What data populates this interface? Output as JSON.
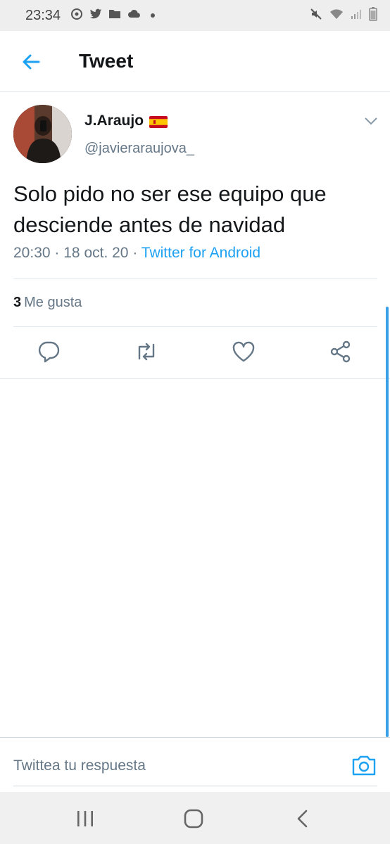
{
  "status_bar": {
    "time": "23:34",
    "left_icons": [
      "sync-icon",
      "twitter-bird-icon",
      "folder-icon",
      "cloud-icon",
      "dot-icon"
    ],
    "right_icons": [
      "mute-icon",
      "wifi-icon",
      "signal-icon",
      "battery-icon"
    ]
  },
  "header": {
    "title": "Tweet",
    "back_icon": "arrow-left-icon"
  },
  "tweet": {
    "author_name": "J.Araujo",
    "flag": "spain-flag-emoji",
    "handle": "@javieraraujova_",
    "text": "Solo pido no ser ese equipo que desciende antes de navidad",
    "time": "20:30",
    "date": "18 oct. 20",
    "source": "Twitter for Android",
    "separator": "·",
    "likes_count": "3",
    "likes_label": "Me gusta"
  },
  "actions": [
    "reply-icon",
    "retweet-icon",
    "like-icon",
    "share-icon"
  ],
  "reply": {
    "placeholder": "Twittea tu respuesta"
  },
  "colors": {
    "accent": "#1da1f2",
    "secondary_text": "#657786",
    "border": "#e1e8ed"
  }
}
